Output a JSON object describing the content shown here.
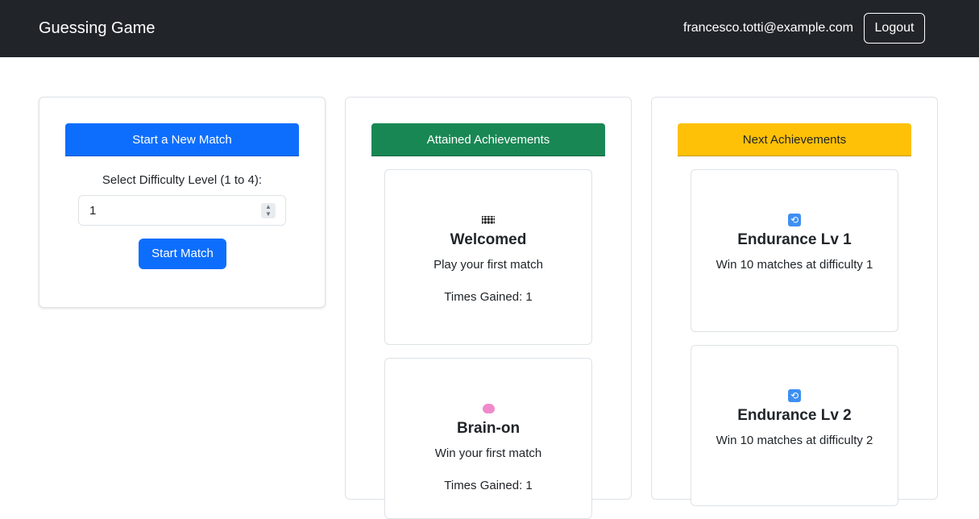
{
  "navbar": {
    "brand": "Guessing Game",
    "user_email": "francesco.totti@example.com",
    "logout_label": "Logout"
  },
  "new_match": {
    "header": "Start a New Match",
    "difficulty_label": "Select Difficulty Level (1 to 4):",
    "difficulty_value": "1",
    "start_label": "Start Match",
    "spinner_up": "▲",
    "spinner_down": "▼"
  },
  "attained": {
    "header": "Attained Achievements",
    "items": [
      {
        "icon": "checkered-flag",
        "title": "Welcomed",
        "description": "Play your first match",
        "times_label": "Times Gained: 1"
      },
      {
        "icon": "brain",
        "title": "Brain-on",
        "description": "Win your first match",
        "times_label": "Times Gained: 1"
      }
    ]
  },
  "next": {
    "header": "Next Achievements",
    "items": [
      {
        "icon": "repeat",
        "icon_glyph": "⟲",
        "title": "Endurance Lv 1",
        "description": "Win 10 matches at difficulty 1"
      },
      {
        "icon": "repeat",
        "icon_glyph": "⟲",
        "title": "Endurance Lv 2",
        "description": "Win 10 matches at difficulty 2"
      }
    ]
  },
  "colors": {
    "navbar": "#212529",
    "primary": "#0d6efd",
    "success": "#198754",
    "warning": "#ffc107"
  }
}
